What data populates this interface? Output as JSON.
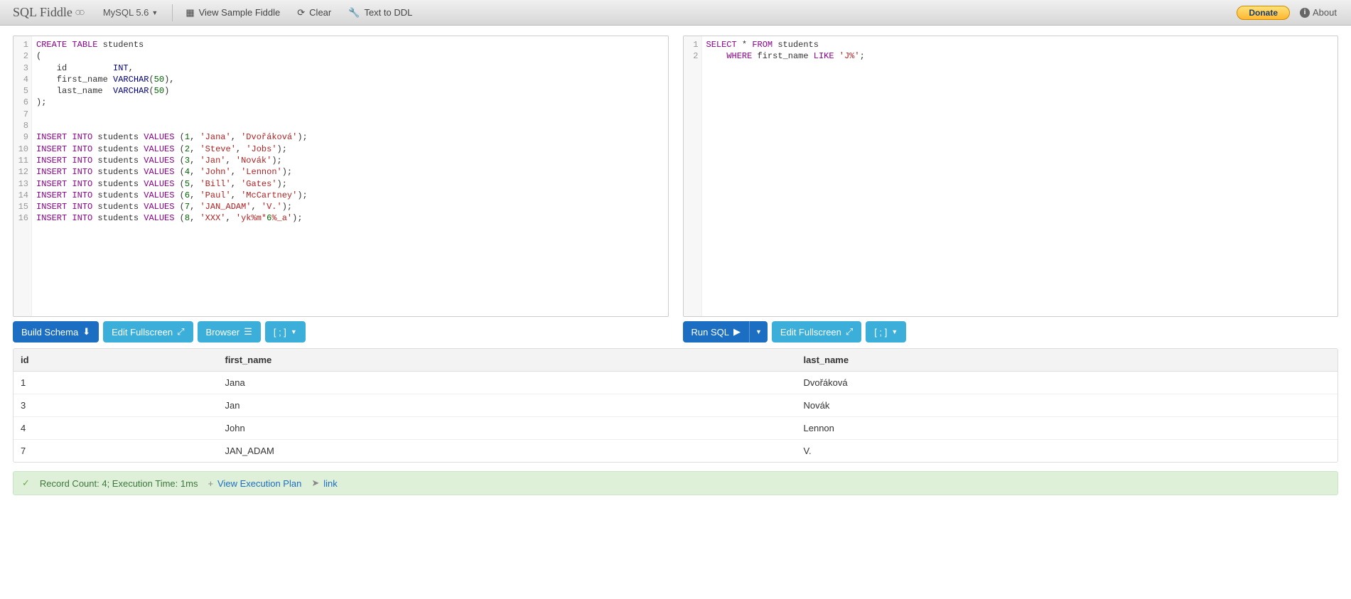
{
  "header": {
    "logo_text": "SQL Fiddle",
    "db_engine": "MySQL 5.6",
    "view_sample": "View Sample Fiddle",
    "clear": "Clear",
    "text_to_ddl": "Text to DDL",
    "donate": "Donate",
    "about": "About"
  },
  "schema_editor": {
    "lines": [
      "CREATE TABLE students",
      "(",
      "    id         INT,",
      "    first_name VARCHAR(50),",
      "    last_name  VARCHAR(50)",
      ");",
      "",
      "",
      "INSERT INTO students VALUES (1, 'Jana', 'Dvořáková');",
      "INSERT INTO students VALUES (2, 'Steve', 'Jobs');",
      "INSERT INTO students VALUES (3, 'Jan', 'Novák');",
      "INSERT INTO students VALUES (4, 'John', 'Lennon');",
      "INSERT INTO students VALUES (5, 'Bill', 'Gates');",
      "INSERT INTO students VALUES (6, 'Paul', 'McCartney');",
      "INSERT INTO students VALUES (7, 'JAN_ADAM', 'V.');",
      "INSERT INTO students VALUES (8, 'XXX', 'yk%m*6%_a');"
    ],
    "actions": {
      "build_schema": "Build Schema",
      "edit_fullscreen": "Edit Fullscreen",
      "browser": "Browser",
      "terminator": "[ ; ]"
    }
  },
  "query_editor": {
    "lines": [
      "SELECT * FROM students",
      "    WHERE first_name LIKE 'J%';"
    ],
    "actions": {
      "run_sql": "Run SQL",
      "edit_fullscreen": "Edit Fullscreen",
      "terminator": "[ ; ]"
    }
  },
  "results": {
    "columns": [
      "id",
      "first_name",
      "last_name"
    ],
    "rows": [
      [
        "1",
        "Jana",
        "Dvořáková"
      ],
      [
        "3",
        "Jan",
        "Novák"
      ],
      [
        "4",
        "John",
        "Lennon"
      ],
      [
        "7",
        "JAN_ADAM",
        "V."
      ]
    ]
  },
  "status": {
    "summary": "Record Count: 4; Execution Time: 1ms",
    "exec_plan": "View Execution Plan",
    "link": "link"
  }
}
